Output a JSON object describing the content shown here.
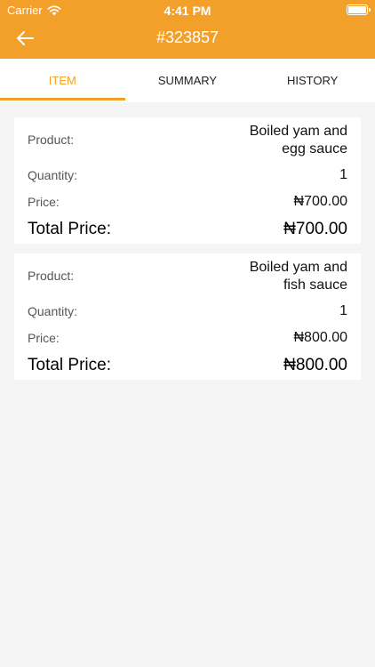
{
  "status_bar": {
    "carrier": "Carrier",
    "time": "4:41 PM"
  },
  "header": {
    "title": "#323857"
  },
  "tabs": [
    {
      "label": "ITEM",
      "active": true
    },
    {
      "label": "SUMMARY",
      "active": false
    },
    {
      "label": "HISTORY",
      "active": false
    }
  ],
  "items": [
    {
      "product_label": "Product:",
      "product_value": "Boiled yam and egg sauce",
      "quantity_label": "Quantity:",
      "quantity_value": "1",
      "price_label": "Price:",
      "price_value": "₦700.00",
      "total_label": "Total Price:",
      "total_value": "₦700.00"
    },
    {
      "product_label": "Product:",
      "product_value": "Boiled yam and fish sauce",
      "quantity_label": "Quantity:",
      "quantity_value": "1",
      "price_label": "Price:",
      "price_value": "₦800.00",
      "total_label": "Total Price:",
      "total_value": "₦800.00"
    }
  ],
  "colors": {
    "accent": "#f3a02b",
    "background": "#f5f5f5"
  },
  "icons": {
    "back": "arrow-left-icon",
    "wifi": "wifi-icon",
    "battery": "battery-icon"
  }
}
